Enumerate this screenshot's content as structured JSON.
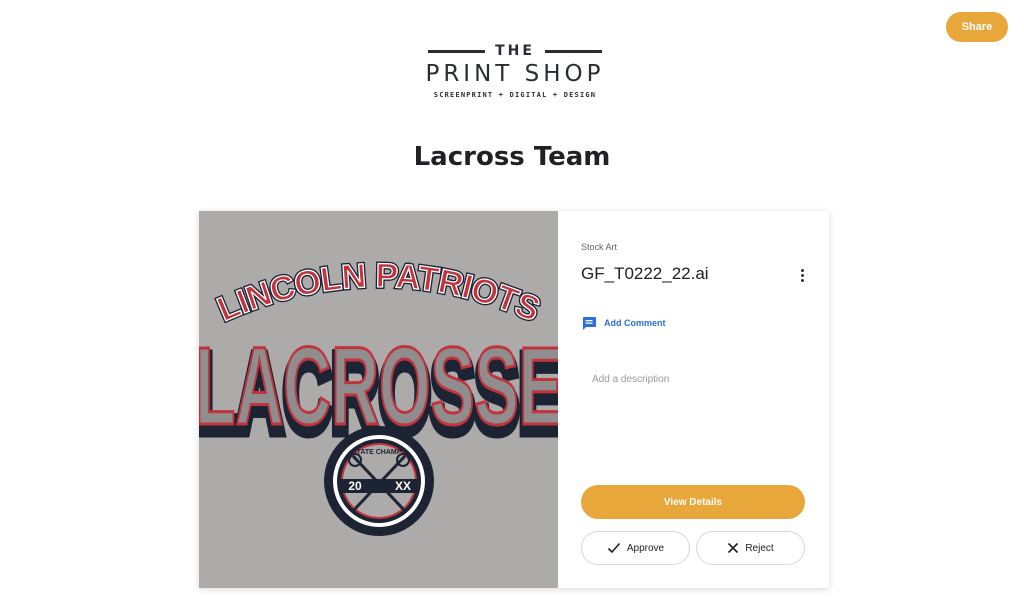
{
  "header": {
    "share_label": "Share",
    "logo": {
      "the": "THE",
      "main": "PRINT SHOP",
      "sub": "SCREENPRINT + DIGITAL + DESIGN"
    }
  },
  "page": {
    "title": "Lacross Team"
  },
  "artwork": {
    "line1": "LINCOLN PATRIOTS",
    "line2": "LACROSSE",
    "badge_top": "STATE CHAMPS",
    "badge_left": "20",
    "badge_right": "XX"
  },
  "details": {
    "category": "Stock Art",
    "file_name": "GF_T0222_22.ai",
    "add_comment_label": "Add Comment",
    "description_placeholder": "Add a description",
    "view_details_label": "View Details",
    "approve_label": "Approve",
    "reject_label": "Reject"
  },
  "colors": {
    "accent": "#e8a73a",
    "link": "#2a6fdb",
    "art_background": "#adaaaa",
    "art_red": "#c1343d",
    "art_navy": "#1c2333"
  },
  "icons": {
    "more": "more-vertical-icon",
    "comment": "comment-icon",
    "approve": "check-icon",
    "reject": "close-icon"
  }
}
